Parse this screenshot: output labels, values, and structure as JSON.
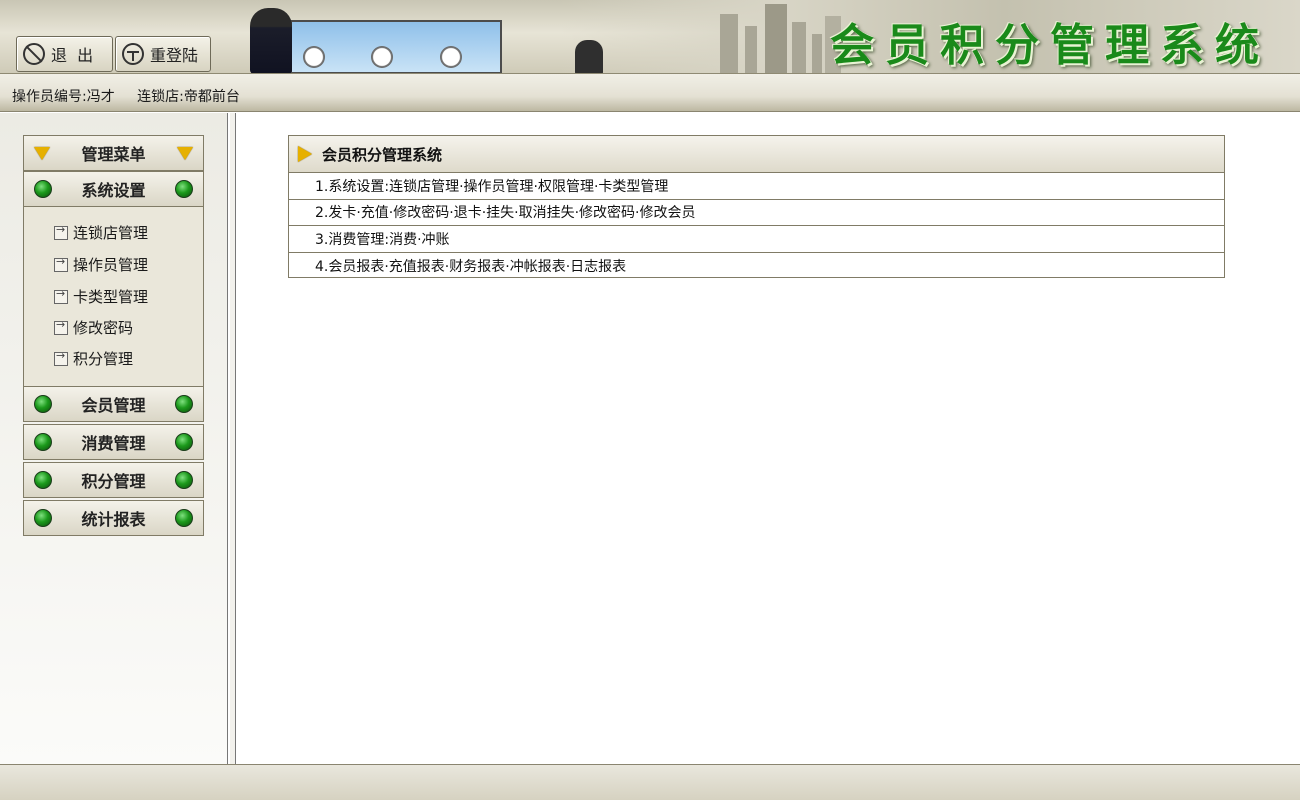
{
  "header": {
    "system_title": "会员积分管理系统",
    "logout_label": "退  出",
    "relogin_label": "重登陆"
  },
  "info": {
    "operator": "操作员编号:冯才",
    "store": "连锁店:帝都前台"
  },
  "sidebar": {
    "menu_title": "管理菜单",
    "sections": [
      {
        "label": "系统设置"
      },
      {
        "label": "会员管理"
      },
      {
        "label": "消费管理"
      },
      {
        "label": "积分管理"
      },
      {
        "label": "统计报表"
      }
    ],
    "sub_items": [
      {
        "label": "连锁店管理"
      },
      {
        "label": "操作员管理"
      },
      {
        "label": "卡类型管理"
      },
      {
        "label": "修改密码"
      },
      {
        "label": "积分管理"
      }
    ]
  },
  "main": {
    "box_title": "会员积分管理系统",
    "rows": [
      {
        "text": "1.系统设置:连锁店管理·操作员管理·权限管理·卡类型管理"
      },
      {
        "text": "2.发卡·充值·修改密码·退卡·挂失·取消挂失·修改密码·修改会员"
      },
      {
        "text": "3.消费管理:消费·冲账"
      },
      {
        "text": "4.会员报表·充值报表·财务报表·冲帐报表·日志报表"
      }
    ]
  },
  "colors": {
    "title_green": "#1a8a1a",
    "indicator_green": "#1c9a1c",
    "arrow_yellow": "#e6b000"
  }
}
